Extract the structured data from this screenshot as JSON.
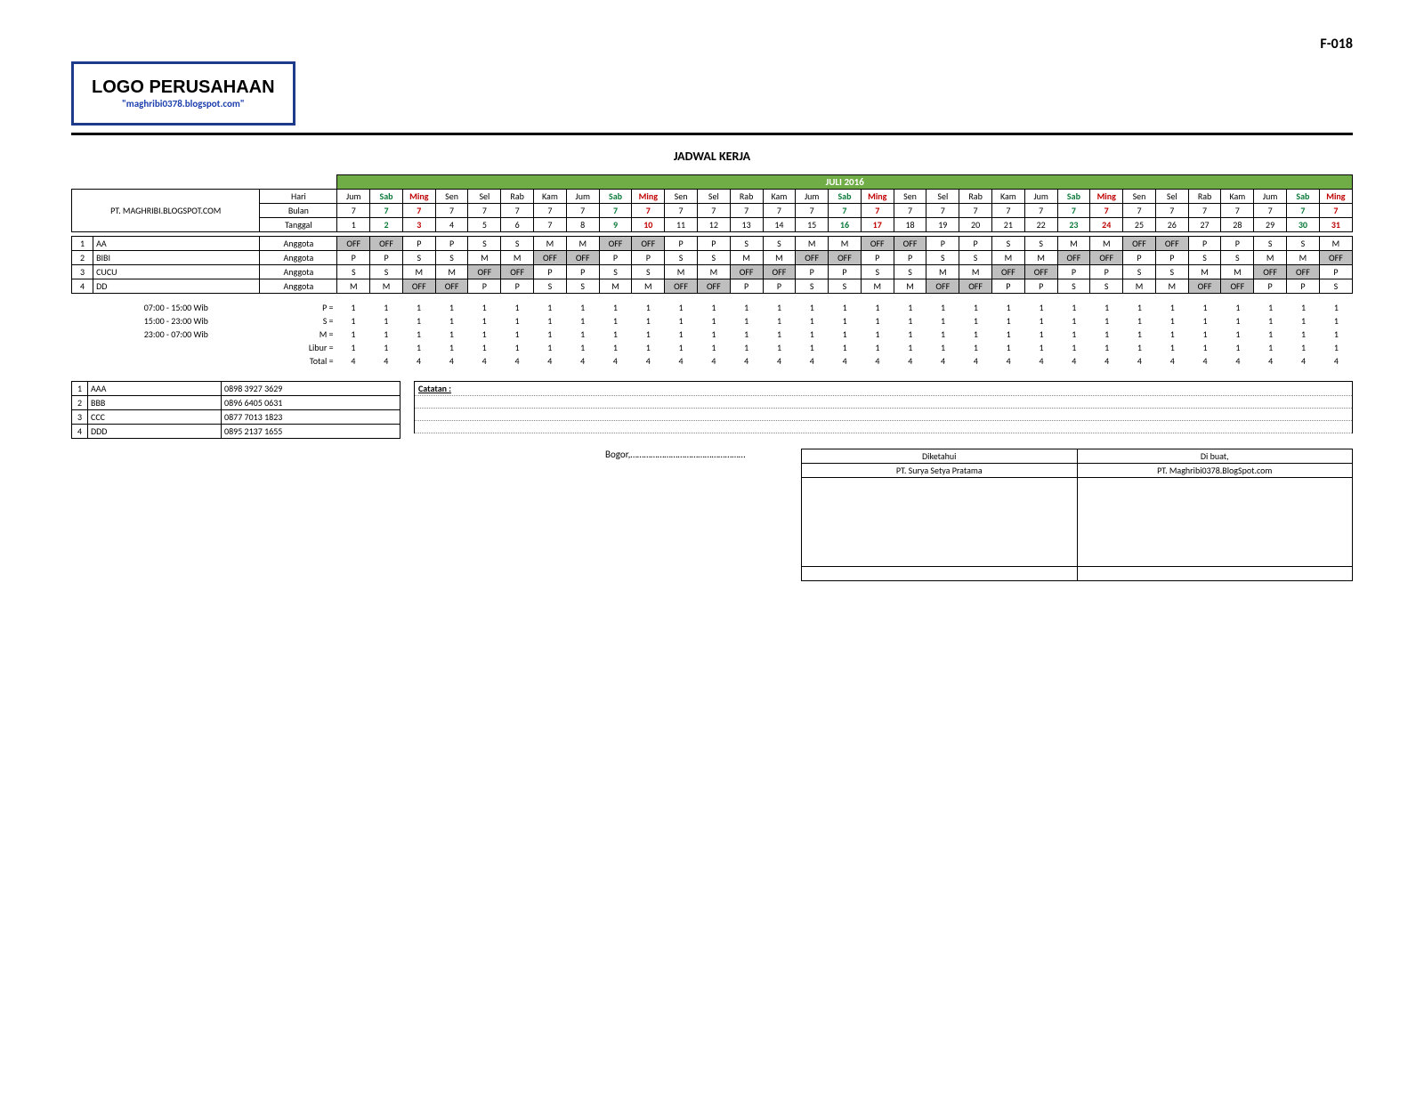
{
  "form_code": "F-018",
  "logo": {
    "title": "LOGO PERUSAHAAN",
    "sub": "\"maghribi0378.blogspot.com\""
  },
  "page_title": "JADWAL KERJA",
  "company": "PT. MAGHRIBI.BLOGSPOT.COM",
  "month_header": "JULI 2016",
  "header_rows": {
    "hari_label": "Hari",
    "bulan_label": "Bulan",
    "tanggal_label": "Tanggal"
  },
  "days": [
    "Jum",
    "Sab",
    "Ming",
    "Sen",
    "Sel",
    "Rab",
    "Kam",
    "Jum",
    "Sab",
    "Ming",
    "Sen",
    "Sel",
    "Rab",
    "Kam",
    "Jum",
    "Sab",
    "Ming",
    "Sen",
    "Sel",
    "Rab",
    "Kam",
    "Jum",
    "Sab",
    "Ming",
    "Sen",
    "Sel",
    "Rab",
    "Kam",
    "Jum",
    "Sab",
    "Ming"
  ],
  "day_type": [
    "",
    "sat",
    "sun",
    "",
    "",
    "",
    "",
    "",
    "sat",
    "sun",
    "",
    "",
    "",
    "",
    "",
    "sat",
    "sun",
    "",
    "",
    "",
    "",
    "",
    "sat",
    "sun",
    "",
    "",
    "",
    "",
    "",
    "sat",
    "sun"
  ],
  "bulan_values": [
    "7",
    "7",
    "7",
    "7",
    "7",
    "7",
    "7",
    "7",
    "7",
    "7",
    "7",
    "7",
    "7",
    "7",
    "7",
    "7",
    "7",
    "7",
    "7",
    "7",
    "7",
    "7",
    "7",
    "7",
    "7",
    "7",
    "7",
    "7",
    "7",
    "7",
    "7"
  ],
  "tanggal_values": [
    "1",
    "2",
    "3",
    "4",
    "5",
    "6",
    "7",
    "8",
    "9",
    "10",
    "11",
    "12",
    "13",
    "14",
    "15",
    "16",
    "17",
    "18",
    "19",
    "20",
    "21",
    "22",
    "23",
    "24",
    "25",
    "26",
    "27",
    "28",
    "29",
    "30",
    "31"
  ],
  "employees": [
    {
      "idx": "1",
      "name": "AA",
      "role": "Anggota",
      "shifts": [
        "OFF",
        "OFF",
        "P",
        "P",
        "S",
        "S",
        "M",
        "M",
        "OFF",
        "OFF",
        "P",
        "P",
        "S",
        "S",
        "M",
        "M",
        "OFF",
        "OFF",
        "P",
        "P",
        "S",
        "S",
        "M",
        "M",
        "OFF",
        "OFF",
        "P",
        "P",
        "S",
        "S",
        "M"
      ]
    },
    {
      "idx": "2",
      "name": "BIBI",
      "role": "Anggota",
      "shifts": [
        "P",
        "P",
        "S",
        "S",
        "M",
        "M",
        "OFF",
        "OFF",
        "P",
        "P",
        "S",
        "S",
        "M",
        "M",
        "OFF",
        "OFF",
        "P",
        "P",
        "S",
        "S",
        "M",
        "M",
        "OFF",
        "OFF",
        "P",
        "P",
        "S",
        "S",
        "M",
        "M",
        "OFF"
      ]
    },
    {
      "idx": "3",
      "name": "CUCU",
      "role": "Anggota",
      "shifts": [
        "S",
        "S",
        "M",
        "M",
        "OFF",
        "OFF",
        "P",
        "P",
        "S",
        "S",
        "M",
        "M",
        "OFF",
        "OFF",
        "P",
        "P",
        "S",
        "S",
        "M",
        "M",
        "OFF",
        "OFF",
        "P",
        "P",
        "S",
        "S",
        "M",
        "M",
        "OFF",
        "OFF",
        "P"
      ]
    },
    {
      "idx": "4",
      "name": "DD",
      "role": "Anggota",
      "shifts": [
        "M",
        "M",
        "OFF",
        "OFF",
        "P",
        "P",
        "S",
        "S",
        "M",
        "M",
        "OFF",
        "OFF",
        "P",
        "P",
        "S",
        "S",
        "M",
        "M",
        "OFF",
        "OFF",
        "P",
        "P",
        "S",
        "S",
        "M",
        "M",
        "OFF",
        "OFF",
        "P",
        "P",
        "S"
      ]
    }
  ],
  "shift_legend": [
    {
      "time": "07:00 - 15:00 Wib",
      "code": "P ="
    },
    {
      "time": "15:00 - 23:00 Wib",
      "code": "S ="
    },
    {
      "time": "23:00 - 07:00 Wib",
      "code": "M ="
    }
  ],
  "summary_extra": [
    {
      "label": "Libur ="
    },
    {
      "label": "Total ="
    }
  ],
  "summary_ones": [
    "1",
    "1",
    "1",
    "1",
    "1",
    "1",
    "1",
    "1",
    "1",
    "1",
    "1",
    "1",
    "1",
    "1",
    "1",
    "1",
    "1",
    "1",
    "1",
    "1",
    "1",
    "1",
    "1",
    "1",
    "1",
    "1",
    "1",
    "1",
    "1",
    "1",
    "1"
  ],
  "summary_fours": [
    "4",
    "4",
    "4",
    "4",
    "4",
    "4",
    "4",
    "4",
    "4",
    "4",
    "4",
    "4",
    "4",
    "4",
    "4",
    "4",
    "4",
    "4",
    "4",
    "4",
    "4",
    "4",
    "4",
    "4",
    "4",
    "4",
    "4",
    "4",
    "4",
    "4",
    "4"
  ],
  "contacts": [
    {
      "idx": "1",
      "name": "AAA",
      "phone": "0898 3927 3629"
    },
    {
      "idx": "2",
      "name": "BBB",
      "phone": "0896 6405 0631"
    },
    {
      "idx": "3",
      "name": "CCC",
      "phone": "0877 7013 1823"
    },
    {
      "idx": "4",
      "name": "DDD",
      "phone": "0895 2137 1655"
    }
  ],
  "catatan_label": "Catatan :",
  "bogor_label": "Bogor,……………………………………………",
  "signatures": {
    "left_header": "Diketahui",
    "left_name": "PT. Surya Setya Pratama",
    "right_header": "Di buat,",
    "right_name": "PT. Maghribi0378.BlogSpot.com"
  }
}
